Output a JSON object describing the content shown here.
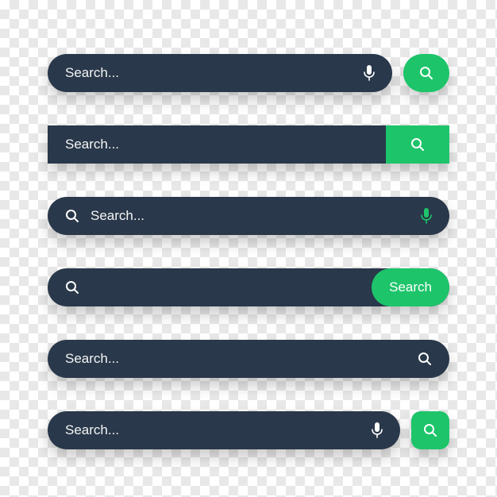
{
  "search": {
    "placeholder": "Search...",
    "button_label": "Search"
  },
  "colors": {
    "bar_bg": "#29384a",
    "accent": "#1dc46a",
    "text": "#ffffff"
  },
  "icons": {
    "mic": "microphone-icon",
    "search": "search-icon"
  }
}
